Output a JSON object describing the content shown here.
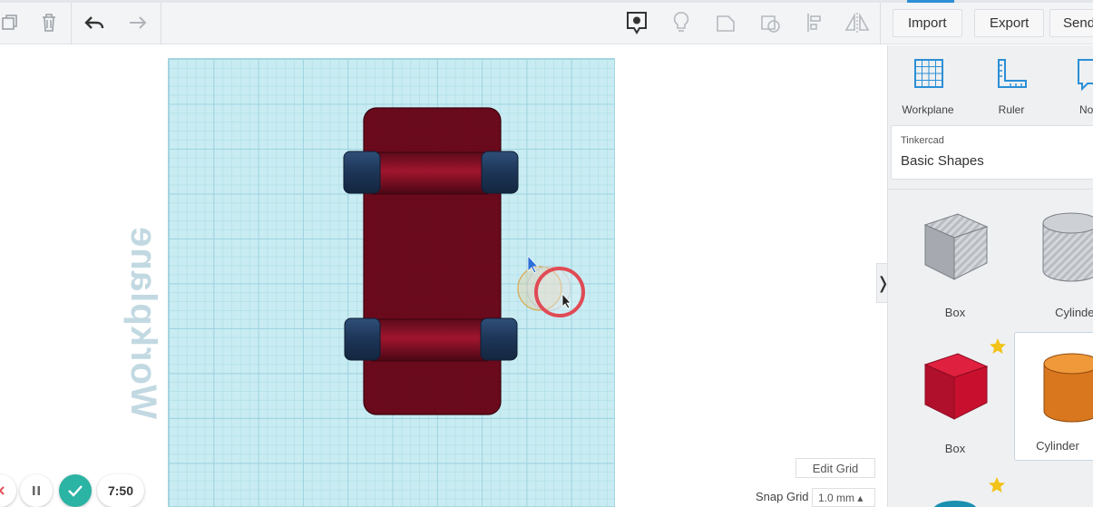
{
  "toolbar": {
    "copy_icon": "copy-icon",
    "delete_icon": "trash-icon",
    "undo_icon": "undo-icon",
    "redo_icon": "redo-icon",
    "view_icon": "view-icon",
    "light_icon": "lightbulb-icon",
    "import_label": "Import",
    "export_label": "Export",
    "send_label": "Send"
  },
  "canvas": {
    "workplane_label": "Workplane",
    "edit_grid_label": "Edit Grid",
    "snap_grid_label": "Snap Grid",
    "snap_grid_value": "1.0 mm ▴"
  },
  "controls": {
    "timer": "7:50"
  },
  "panel": {
    "tools": [
      {
        "label": "Workplane",
        "icon": "workplane-icon"
      },
      {
        "label": "Ruler",
        "icon": "ruler-icon"
      },
      {
        "label": "No",
        "icon": "notes-icon"
      }
    ],
    "library": {
      "source": "Tinkercad",
      "name": "Basic Shapes"
    },
    "shapes": [
      {
        "label": "Box"
      },
      {
        "label": "Cylinder"
      },
      {
        "label": "Box"
      },
      {
        "label": "Cylinder"
      }
    ],
    "colors": {
      "accent": "#2c8fd6",
      "box_red": "#c8102e",
      "cylinder_orange": "#d9771e",
      "car_body": "#6b0a1c",
      "wheel": "#1f3a5f"
    }
  }
}
